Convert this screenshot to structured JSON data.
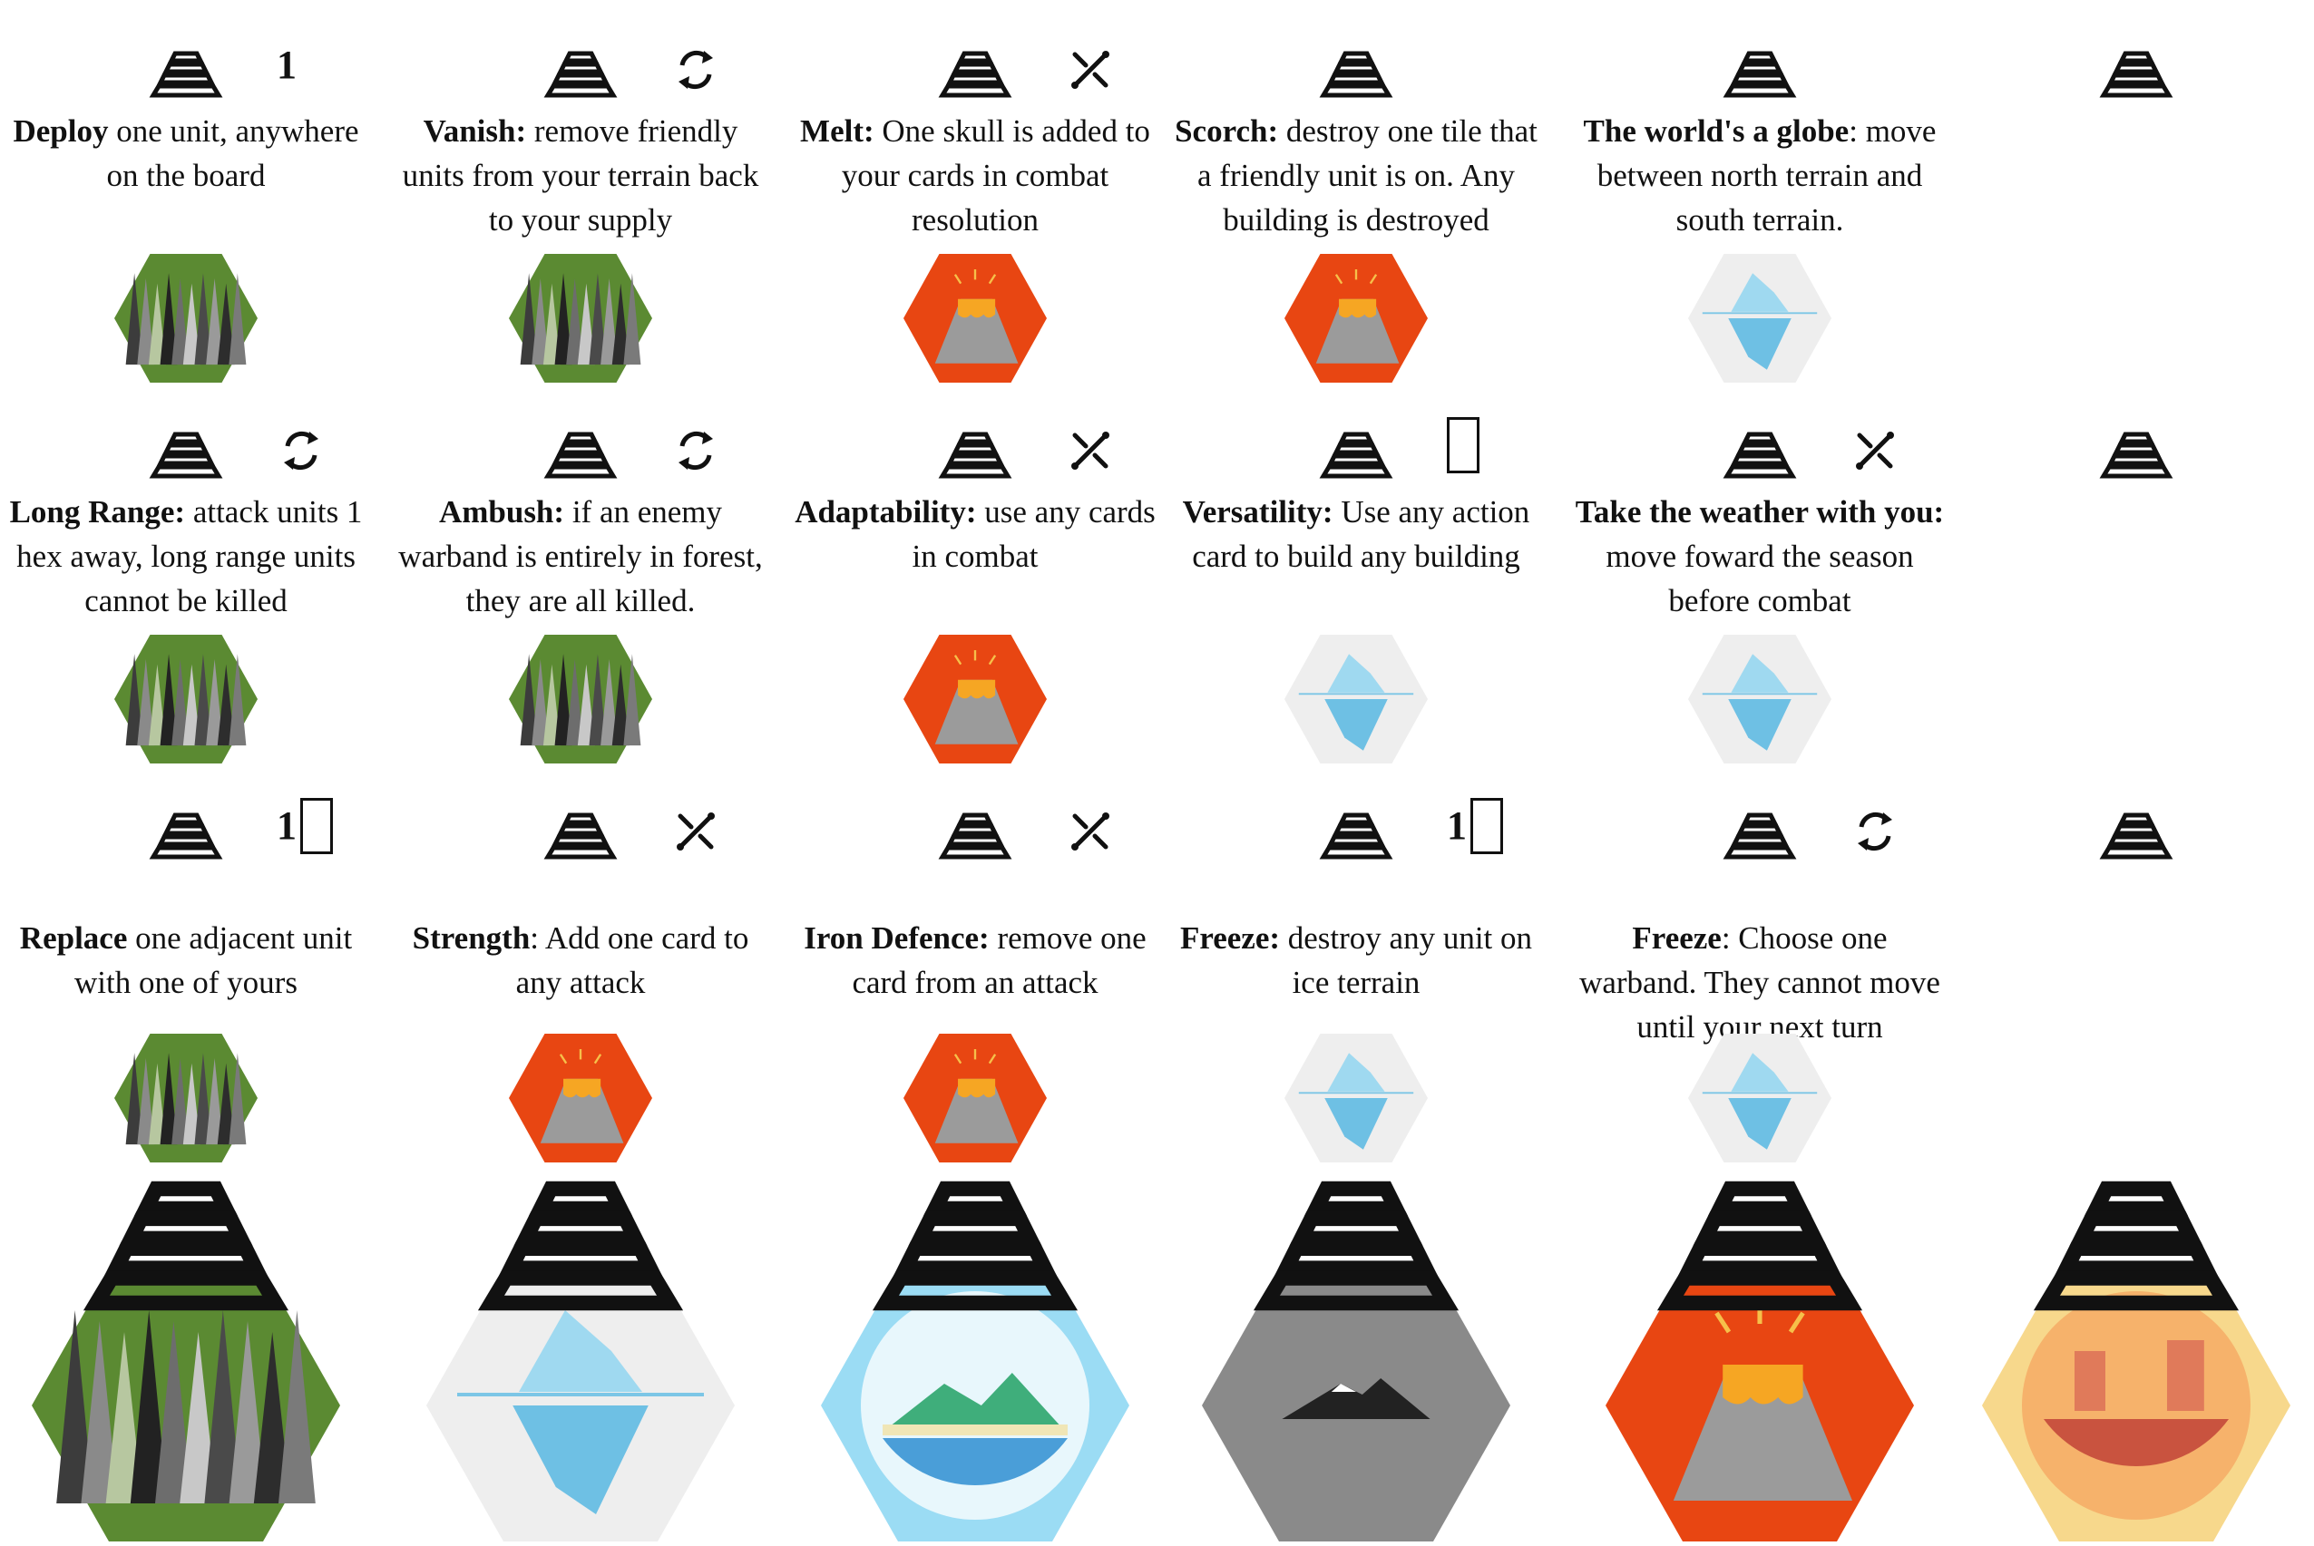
{
  "abilities": [
    {
      "id": "deploy",
      "name": "Deploy",
      "desc": " one unit, anywhere on the board",
      "badge_number": "1",
      "badge_icon": "",
      "terrain": "forest",
      "row": 0,
      "col": 0
    },
    {
      "id": "vanish",
      "name": "Vanish:",
      "desc": " remove friendly units from your terrain back to your supply",
      "badge_number": "",
      "badge_icon": "cycle-icon",
      "terrain": "forest",
      "row": 0,
      "col": 1
    },
    {
      "id": "melt",
      "name": "Melt:",
      "desc": " One skull is added to your cards in combat resolution",
      "badge_number": "",
      "badge_icon": "swords-icon",
      "terrain": "volcano",
      "row": 0,
      "col": 2
    },
    {
      "id": "scorch",
      "name": "Scorch:",
      "desc": " destroy one tile that a friendly unit is on. Any building is destroyed",
      "badge_number": "",
      "badge_icon": "",
      "terrain": "volcano",
      "row": 0,
      "col": 3
    },
    {
      "id": "globe",
      "name": "The world's a globe",
      "desc": ": move between north terrain and south terrain.",
      "badge_number": "",
      "badge_icon": "",
      "terrain": "ice",
      "row": 0,
      "col": 4
    },
    {
      "id": "blank1",
      "name": "",
      "desc": "",
      "badge_number": "",
      "badge_icon": "",
      "terrain": "",
      "row": 0,
      "col": 5
    },
    {
      "id": "longrange",
      "name": "Long Range:",
      "desc": " attack units 1 hex away, long range units cannot be killed",
      "badge_number": "",
      "badge_icon": "cycle-icon",
      "terrain": "forest",
      "row": 1,
      "col": 0
    },
    {
      "id": "ambush",
      "name": "Ambush:",
      "desc": " if an enemy warband is entirely in forest, they are all killed.",
      "badge_number": "",
      "badge_icon": "cycle-icon",
      "terrain": "forest",
      "row": 1,
      "col": 1
    },
    {
      "id": "adapt",
      "name": "Adaptability:",
      "desc": " use any cards in combat",
      "badge_number": "",
      "badge_icon": "swords-icon",
      "terrain": "volcano",
      "row": 1,
      "col": 2
    },
    {
      "id": "versatility",
      "name": "Versatility:",
      "desc": " Use any action card to build any building",
      "badge_number": "",
      "badge_icon": "card-icon",
      "terrain": "ice",
      "row": 1,
      "col": 3
    },
    {
      "id": "weather",
      "name": "Take the weather with you:",
      "desc": " move foward the season before combat",
      "badge_number": "",
      "badge_icon": "swords-icon",
      "terrain": "ice",
      "row": 1,
      "col": 4
    },
    {
      "id": "blank2",
      "name": "",
      "desc": "",
      "badge_number": "",
      "badge_icon": "",
      "terrain": "",
      "row": 1,
      "col": 5
    },
    {
      "id": "replace",
      "name": "Replace",
      "desc": " one adjacent unit with one of yours",
      "badge_number": "1",
      "badge_icon": "card-icon",
      "terrain": "forest",
      "row": 2,
      "col": 0
    },
    {
      "id": "strength",
      "name": "Strength",
      "desc": ": Add one card to any attack",
      "badge_number": "",
      "badge_icon": "swords-icon",
      "terrain": "volcano",
      "row": 2,
      "col": 1
    },
    {
      "id": "iron",
      "name": "Iron Defence:",
      "desc": " remove one card from an attack",
      "badge_number": "",
      "badge_icon": "swords-icon",
      "terrain": "volcano",
      "row": 2,
      "col": 2
    },
    {
      "id": "freeze1",
      "name": "Freeze:",
      "desc": " destroy any unit on ice terrain",
      "badge_number": "1",
      "badge_icon": "card-icon",
      "terrain": "ice",
      "row": 2,
      "col": 3
    },
    {
      "id": "freeze2",
      "name": "Freeze",
      "desc": ": Choose one warband. They cannot move until your next turn",
      "badge_number": "",
      "badge_icon": "cycle-icon",
      "terrain": "ice",
      "row": 2,
      "col": 4
    },
    {
      "id": "blank3",
      "name": "",
      "desc": "",
      "badge_number": "",
      "badge_icon": "",
      "terrain": "",
      "row": 2,
      "col": 5
    }
  ],
  "tiles": [
    "forest",
    "ice",
    "island",
    "mountain",
    "volcano",
    "desert"
  ],
  "colors": {
    "forest": "#5b8a32",
    "volcano": "#e84612",
    "ice": "#eeeeee",
    "island": "#9bdcf4",
    "mountain": "#8a8a8a",
    "desert": "#f7d88c"
  }
}
